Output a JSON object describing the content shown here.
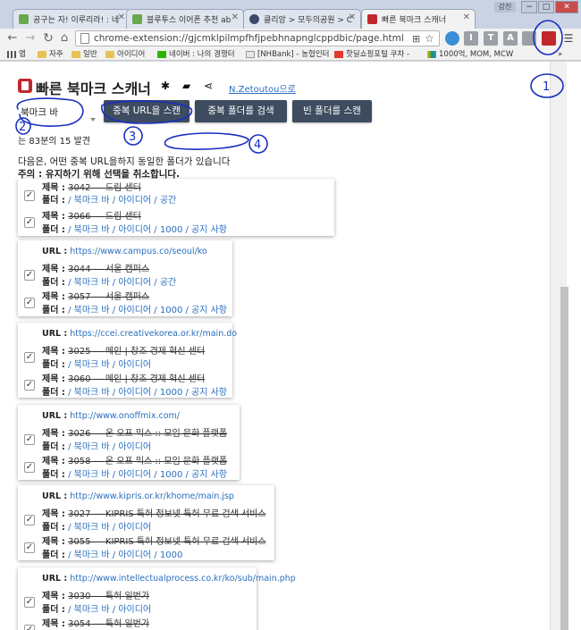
{
  "browser": {
    "tabs": [
      {
        "title": "공구는 자! 이루리라! : 네",
        "favicon": "#6aa84f"
      },
      {
        "title": "블루투스 이어폰 추천 ab",
        "favicon": "#6aa84f"
      },
      {
        "title": "클리앙 > 모두의공원 > C",
        "favicon": "#3b4a6b"
      },
      {
        "title": "빠른 북마크 스캐너",
        "favicon": "#c2272d"
      }
    ],
    "user_label": "강진",
    "window_buttons": [
      "−",
      "□",
      "✕"
    ],
    "url": "chrome-extension://gjcmklpilmpfhfjpebhnapnglcppdbic/page.html",
    "bookmarks": [
      {
        "label": "앱",
        "icon": "apps-grid"
      },
      {
        "label": "자주",
        "icon": "folder"
      },
      {
        "label": "일반",
        "icon": "folder"
      },
      {
        "label": "아이디어",
        "icon": "folder"
      },
      {
        "label": "네이버 : 나의 경쟁터",
        "icon": "naver"
      },
      {
        "label": "[NHBank] - 농협인터",
        "icon": "nhbank"
      },
      {
        "label": "핫딜쇼핑포털 쿠차 -",
        "icon": "coocha"
      },
      {
        "label": "1000억, MOM, MCW",
        "icon": "drive"
      }
    ],
    "bookmarks_more": "»"
  },
  "app": {
    "title": "빠른 북마크 스캐너",
    "author_link": "N.Zetoutou으로",
    "folder_select": "북마크 바",
    "buttons": {
      "scan_dup_url": "중복 URL을 스캔",
      "search_dup_folder": "중복 폴더를 검색",
      "scan_empty_folder": "빈 폴더를 스캔"
    },
    "status": "는 83분의 15 발견",
    "description": "다음은, 어떤 중복 URL을하지 동일한 폴더가 있습니다",
    "notice": "주의 : 유지하기 위해 선택을 취소합니다."
  },
  "labels": {
    "url": "URL :",
    "title": "제목 :",
    "folder": "폴더 :"
  },
  "groups": [
    {
      "url": "",
      "entries": [
        {
          "id": "3042",
          "title": "드림 센터",
          "folder": "/ 북마크 바 / 아이디어 / 공간",
          "checked": true
        },
        {
          "id": "3066",
          "title": "드림 센터",
          "folder": "/ 북마크 바 / 아이디어 / 1000 / 공지 사항",
          "checked": true
        }
      ]
    },
    {
      "url": "https://www.campus.co/seoul/ko",
      "entries": [
        {
          "id": "3044",
          "title": "서울 캠퍼스",
          "folder": "/ 북마크 바 / 아이디어 / 공간",
          "checked": true
        },
        {
          "id": "3057",
          "title": "서울 캠퍼스",
          "folder": "/ 북마크 바 / 아이디어 / 1000 / 공지 사항",
          "checked": true
        }
      ]
    },
    {
      "url": "https://ccei.creativekorea.or.kr/main.do",
      "entries": [
        {
          "id": "3025",
          "title": "메인 | 창조 경제 혁신 센터",
          "folder": "/ 북마크 바 / 아이디어",
          "checked": true
        },
        {
          "id": "3060",
          "title": "메인 | 창조 경제 혁신 센터",
          "folder": "/ 북마크 바 / 아이디어 / 1000 / 공지 사항",
          "checked": true
        }
      ]
    },
    {
      "url": "http://www.onoffmix.com/",
      "entries": [
        {
          "id": "3026",
          "title": "온 오프 믹스 :: 모임 문화 플랫폼",
          "folder": "/ 북마크 바 / 아이디어",
          "checked": true
        },
        {
          "id": "3058",
          "title": "온 오프 믹스 :: 모임 문화 플랫폼",
          "folder": "/ 북마크 바 / 아이디어 / 1000 / 공지 사항",
          "checked": true
        }
      ]
    },
    {
      "url": "http://www.kipris.or.kr/khome/main.jsp",
      "entries": [
        {
          "id": "3027",
          "title": "KIPRIS 특허 정보넷 특허 무료 검색 서비스",
          "folder": "/ 북마크 바 / 아이디어",
          "checked": true
        },
        {
          "id": "3055",
          "title": "KIPRIS 특허 정보넷 특허 무료 검색 서비스",
          "folder": "/ 북마크 바 / 아이디어 / 1000",
          "checked": true
        }
      ]
    },
    {
      "url": "http://www.intellectualprocess.co.kr/ko/sub/main.php",
      "entries": [
        {
          "id": "3030",
          "title": "특허 일번가",
          "folder": "/ 북마크 바 / 아이디어",
          "checked": true
        },
        {
          "id": "3054",
          "title": "특허 일번가",
          "folder": "",
          "checked": true
        }
      ]
    }
  ],
  "annotations": [
    "1",
    "2",
    "3",
    "4"
  ],
  "colors": {
    "accent_red": "#c2272d",
    "button_bg": "#3d4c5f",
    "link": "#2a6fbf",
    "ink": "#1a2fbf"
  }
}
